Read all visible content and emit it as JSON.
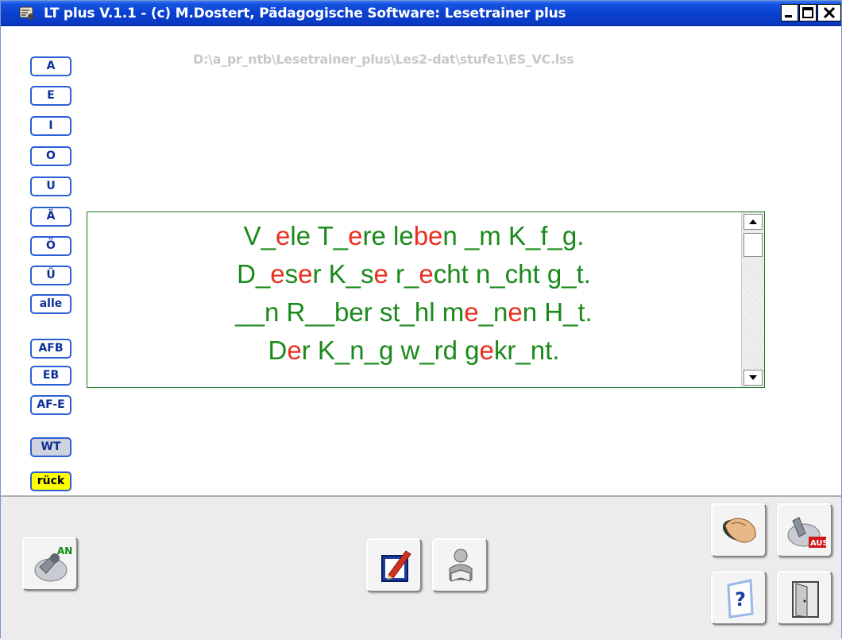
{
  "window": {
    "title": "LT plus   V.1.1 - (c) M.Dostert, Pädagogische Software: Lesetrainer plus",
    "controls": {
      "minimize": "_",
      "maximize": "□",
      "close": "×"
    }
  },
  "file_path": "D:\\a_pr_ntb\\Lesetrainer_plus\\Les2-dat\\stufe1\\ES_VC.lss",
  "vowel_buttons": [
    "A",
    "E",
    "I",
    "O",
    "U",
    "Ä",
    "Ö",
    "Ü",
    "alle"
  ],
  "mode_buttons": [
    "AFB",
    "EB",
    "AF-E"
  ],
  "wt_button": "WT",
  "back_button": "rück",
  "text_lines": [
    [
      [
        "V_",
        "g"
      ],
      [
        "e",
        "r"
      ],
      [
        "le T_",
        "g"
      ],
      [
        "e",
        "r"
      ],
      [
        "re le",
        "g"
      ],
      [
        "be",
        "r"
      ],
      [
        "n _m K_f_g.",
        "g"
      ]
    ],
    [
      [
        "D_",
        "g"
      ],
      [
        "e",
        "r"
      ],
      [
        "s",
        "g"
      ],
      [
        "e",
        "r"
      ],
      [
        "r K_s",
        "g"
      ],
      [
        "e",
        "r"
      ],
      [
        " r_",
        "g"
      ],
      [
        "e",
        "r"
      ],
      [
        "cht n_cht g_t.",
        "g"
      ]
    ],
    [
      [
        "__n R__ber st_hl m",
        "g"
      ],
      [
        "e",
        "r"
      ],
      [
        "_n",
        "g"
      ],
      [
        "e",
        "r"
      ],
      [
        "n H_t.",
        "g"
      ]
    ],
    [
      [
        "D",
        "g"
      ],
      [
        "e",
        "r"
      ],
      [
        "r K_n_g w_rd g",
        "g"
      ],
      [
        "e",
        "r"
      ],
      [
        "kr_nt.",
        "g"
      ]
    ]
  ],
  "colors": {
    "titlebar": "#0a3fd0",
    "text_green": "#1a8a1a",
    "text_red": "#e83020",
    "button_border": "#2a5fd6",
    "rueck_bg": "#ffff00"
  },
  "icons": {
    "an_switch": "an-switch-icon",
    "edit": "pencil-edit-icon",
    "reader": "reading-person-icon",
    "mouse_hand": "mouse-hand-icon",
    "aus_switch": "aus-switch-icon",
    "help": "help-question-icon",
    "exit": "exit-door-icon"
  },
  "labels": {
    "an": "AN",
    "aus": "AUS",
    "help": "?"
  }
}
